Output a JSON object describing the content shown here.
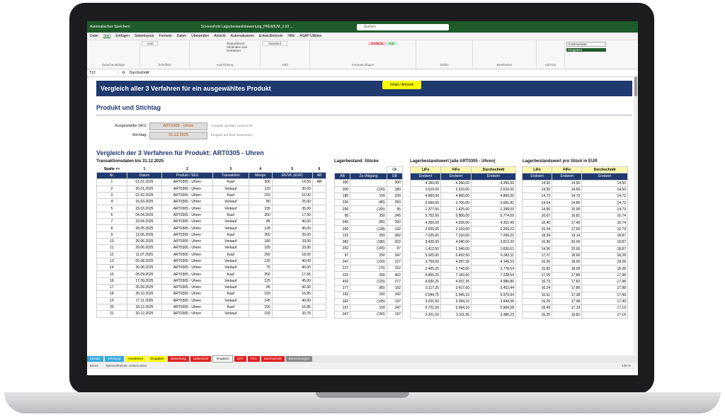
{
  "window": {
    "title": "Screenshots Lagerbestandsbewertung_PREMIUM_2.03 ...",
    "search": "Suchen",
    "autosave": "Automatisches Speichern"
  },
  "ribbon": {
    "tabs": [
      "Datei",
      "Start",
      "Einfügen",
      "Seitenlayout",
      "Formeln",
      "Daten",
      "Überprüfen",
      "Ansicht",
      "Automatisieren",
      "Entwicklertools",
      "Hilfe",
      "ASAP Utilities"
    ],
    "active_index": 1,
    "groups": [
      "Zwischenablage",
      "Schriftart",
      "Ausrichtung",
      "Zahl",
      "Formatvorlagen",
      "Zellen",
      "Bearbeiten",
      "Add-Ins"
    ],
    "font": "Arial",
    "number_format": "Standard",
    "btn_textumbruch": "Textumbruch",
    "btn_verbinden": "Verbinden und zentrieren",
    "style_bad": "Schlecht",
    "style_good": "Gut",
    "btn_kommentare": "Kommentare",
    "btn_freigeben": "Freigeben"
  },
  "formula_bar": {
    "cell": "T12",
    "formula": "Durchschnitt"
  },
  "sheet": {
    "banner": "Vergleich aller 3 Verfahren für ein ausgewähltes Produkt",
    "banner_button": "Inhalt / Anmerk",
    "section1": "Produkt und Stichtag",
    "sku_label": "Ausgewählte SKU:",
    "sku_value": "ART0305 - Uhren",
    "sku_hint": "Auswahl auf Blatt 'Uebersicht'",
    "date_label": "Stichtag:",
    "date_value": "31.12.2025",
    "date_hint": "Eingabe auf Blatt 'Bewertung'",
    "section2": "Vergleich der 3 Verfahren für Produkt: ART0305 - Uhren",
    "sub_trans": "Transaktionsdaten bis 31.12.2025",
    "sub_lager": "Lagerbestand: Stücke",
    "sub_wert": "Lagerbestandswert (alle ART0305 - Uhren)",
    "sub_stueck": "Lagerbestandswert pro Stück in EUR",
    "col_numbers": [
      "Spalte =>",
      "1",
      "2",
      "3",
      "4",
      "5",
      "6"
    ],
    "ok": "Ok",
    "trans_headers": [
      "Nr.",
      "Datum",
      "Produkt / SKU",
      "Transaktion",
      "Menge",
      "EK/VK (EUR)",
      "AB"
    ],
    "lager_headers": [
      "AB",
      "Zu-/Abgang",
      "EB"
    ],
    "method_names": [
      "LiFo",
      "FiFo",
      "Durchschnitt"
    ],
    "wert_headers": [
      "Endwert",
      "Endwert",
      "Endwert"
    ],
    "stueck_headers": [
      "Endwert",
      "Endwert",
      "Endwert"
    ],
    "rows": [
      [
        "1",
        "01.01.2025",
        "ART0305 - Uhren",
        "Kauf",
        "300",
        "14,50",
        "AB",
        "300",
        "-",
        "300",
        "4.350,00",
        "4.350,00",
        "4.350,00",
        "14,50",
        "14,50",
        "14,50"
      ],
      [
        "2",
        "20.01.2025",
        "ART0305 - Uhren",
        "Verkauf",
        "120",
        "30,00",
        "",
        "300",
        "(120)",
        "180",
        "2.610,00",
        "2.610,00",
        "2.610,00",
        "14,50",
        "14,50",
        "14,50"
      ],
      [
        "3",
        "02.02.2025",
        "ART0305 - Uhren",
        "Kauf",
        "150",
        "15,00",
        "",
        "180",
        "150",
        "330",
        "4.860,00",
        "4.860,00",
        "4.860,00",
        "14,73",
        "14,73",
        "14,73"
      ],
      [
        "4",
        "15.03.2025",
        "ART0305 - Uhren",
        "Verkauf",
        "80",
        "25,00",
        "",
        "330",
        "(80)",
        "250",
        "3.660,00",
        "3.700,00",
        "3.681,82",
        "14,64",
        "14,80",
        "14,73"
      ],
      [
        "5",
        "23.03.2025",
        "ART0305 - Uhren",
        "Verkauf",
        "155",
        "35,00",
        "",
        "250",
        "(155)",
        "95",
        "1.377,50",
        "1.425,00",
        "1.399,09",
        "14,50",
        "15,00",
        "14,73"
      ],
      [
        "6",
        "04.04.2025",
        "ART0305 - Uhren",
        "Kauf",
        "250",
        "17,50",
        "",
        "95",
        "250",
        "345",
        "5.752,50",
        "5.800,00",
        "5.774,09",
        "16,67",
        "16,81",
        "16,74"
      ],
      [
        "7",
        "23.04.2025",
        "ART0305 - Uhren",
        "Verkauf",
        "85",
        "40,00",
        "",
        "345",
        "(85)",
        "260",
        "4.260,00",
        "4.525,00",
        "4.351,49",
        "16,40",
        "17,40",
        "16,74"
      ],
      [
        "8",
        "28.05.2025",
        "ART0305 - Uhren",
        "Verkauf",
        "128",
        "45,00",
        "",
        "260",
        "(128)",
        "132",
        "2.025,00",
        "2.310,00",
        "2.209,22",
        "15,34",
        "17,50",
        "16,74"
      ],
      [
        "9",
        "12.06.2025",
        "ART0305 - Uhren",
        "Kauf",
        "250",
        "20,00",
        "",
        "132",
        "250",
        "382",
        "7.025,00",
        "7.310,00",
        "7.209,22",
        "18,39",
        "19,14",
        "18,87"
      ],
      [
        "10",
        "25.06.2025",
        "ART0305 - Uhren",
        "Verkauf",
        "180",
        "33,00",
        "",
        "382",
        "(180)",
        "202",
        "3.425,00",
        "4.040,00",
        "3.812,20",
        "16,96",
        "20,00",
        "18,87"
      ],
      [
        "11",
        "29.06.2025",
        "ART0305 - Uhren",
        "Verkauf",
        "105",
        "33,00",
        "",
        "202",
        "(105)",
        "97",
        "1.412,50",
        "1.940,00",
        "1.830,61",
        "14,56",
        "20,00",
        "18,87"
      ],
      [
        "12",
        "11.07.2025",
        "ART0305 - Uhren",
        "Kauf",
        "250",
        "18,05",
        "",
        "97",
        "250",
        "347",
        "5.925,00",
        "6.452,50",
        "6.343,11",
        "17,07",
        "18,60",
        "18,28"
      ],
      [
        "13",
        "05.08.2025",
        "ART0305 - Uhren",
        "Verkauf",
        "120",
        "40,00",
        "",
        "347",
        "(120)",
        "227",
        "3.759,00",
        "4.097,35",
        "4.149,53",
        "16,56",
        "18,05",
        "18,28"
      ],
      [
        "14",
        "20.08.2025",
        "ART0305 - Uhren",
        "Verkauf",
        "75",
        "40,00",
        "",
        "227",
        "(75)",
        "152",
        "2.405,25",
        "2.743,60",
        "2.778,54",
        "15,82",
        "18,05",
        "18,28"
      ],
      [
        "15",
        "05.09.2025",
        "ART0305 - Uhren",
        "Kauf",
        "250",
        "17,65",
        "",
        "152",
        "250",
        "402",
        "6.855,25",
        "7.193,60",
        "7.228,54",
        "17,05",
        "17,89",
        "17,98"
      ],
      [
        "16",
        "17.09.2025",
        "ART0305 - Uhren",
        "Verkauf",
        "125",
        "45,00",
        "",
        "402",
        "(125)",
        "277",
        "4.630,25",
        "4.937,35",
        "4.980,86",
        "16,72",
        "17,82",
        "17,98"
      ],
      [
        "17",
        "25.09.2025",
        "ART0305 - Uhren",
        "Verkauf",
        "85",
        "42,00",
        "",
        "277",
        "(85)",
        "192",
        "3.117,25",
        "3.417,60",
        "3.452,44",
        "16,24",
        "17,80",
        "17,98"
      ],
      [
        "18",
        "25.10.2025",
        "ART0305 - Uhren",
        "Kauf",
        "150",
        "16,85",
        "",
        "192",
        "150",
        "342",
        "5.644,75",
        "5.945,10",
        "5.979,94",
        "16,51",
        "17,38",
        "17,49"
      ],
      [
        "19",
        "17.11.2025",
        "ART0305 - Uhren",
        "Verkauf",
        "145",
        "40,00",
        "",
        "342",
        "(145)",
        "197",
        "3.201,50",
        "3.364,10",
        "3.444,58",
        "16,25",
        "17,08",
        "17,49"
      ],
      [
        "20",
        "18.12.2025",
        "ART0305 - Uhren",
        "Kauf",
        "150",
        "16,85",
        "",
        "197",
        "150",
        "347",
        "5.721,50",
        "5.964,10",
        "5.964,58",
        "16,49",
        "17,19",
        "17,19"
      ],
      [
        "21",
        "20.12.2025",
        "ART0305 - Uhren",
        "Verkauf",
        "150",
        "33,75",
        "",
        "347",
        "(150)",
        "197",
        "3.201,50",
        "3.311,95",
        "3.386,23",
        "16,25",
        "16,81",
        "17,19"
      ]
    ]
  },
  "sheet_tabs": [
    {
      "label": "Einsatz",
      "color": "#35a9e0"
    },
    {
      "label": "Anleitung",
      "color": "#35a9e0"
    },
    {
      "label": "Annahmen",
      "color": "#ffff00"
    },
    {
      "label": "Eingaben",
      "color": "#ffff00"
    },
    {
      "label": "Bewertung",
      "color": "#e02020"
    },
    {
      "label": "Uebersicht",
      "color": "#e02020"
    },
    {
      "label": "Vergleich",
      "color": "#ffffff"
    },
    {
      "label": "LiFo",
      "color": "#e02020"
    },
    {
      "label": "FiFo",
      "color": "#e02020"
    },
    {
      "label": "Durchschnitt",
      "color": "#e02020"
    },
    {
      "label": "Berechnungen",
      "color": "#888888"
    }
  ],
  "status": {
    "ready": "Bereit",
    "accessibility": "Barrierefreiheit: Untersuchen",
    "zoom": "130 %"
  }
}
